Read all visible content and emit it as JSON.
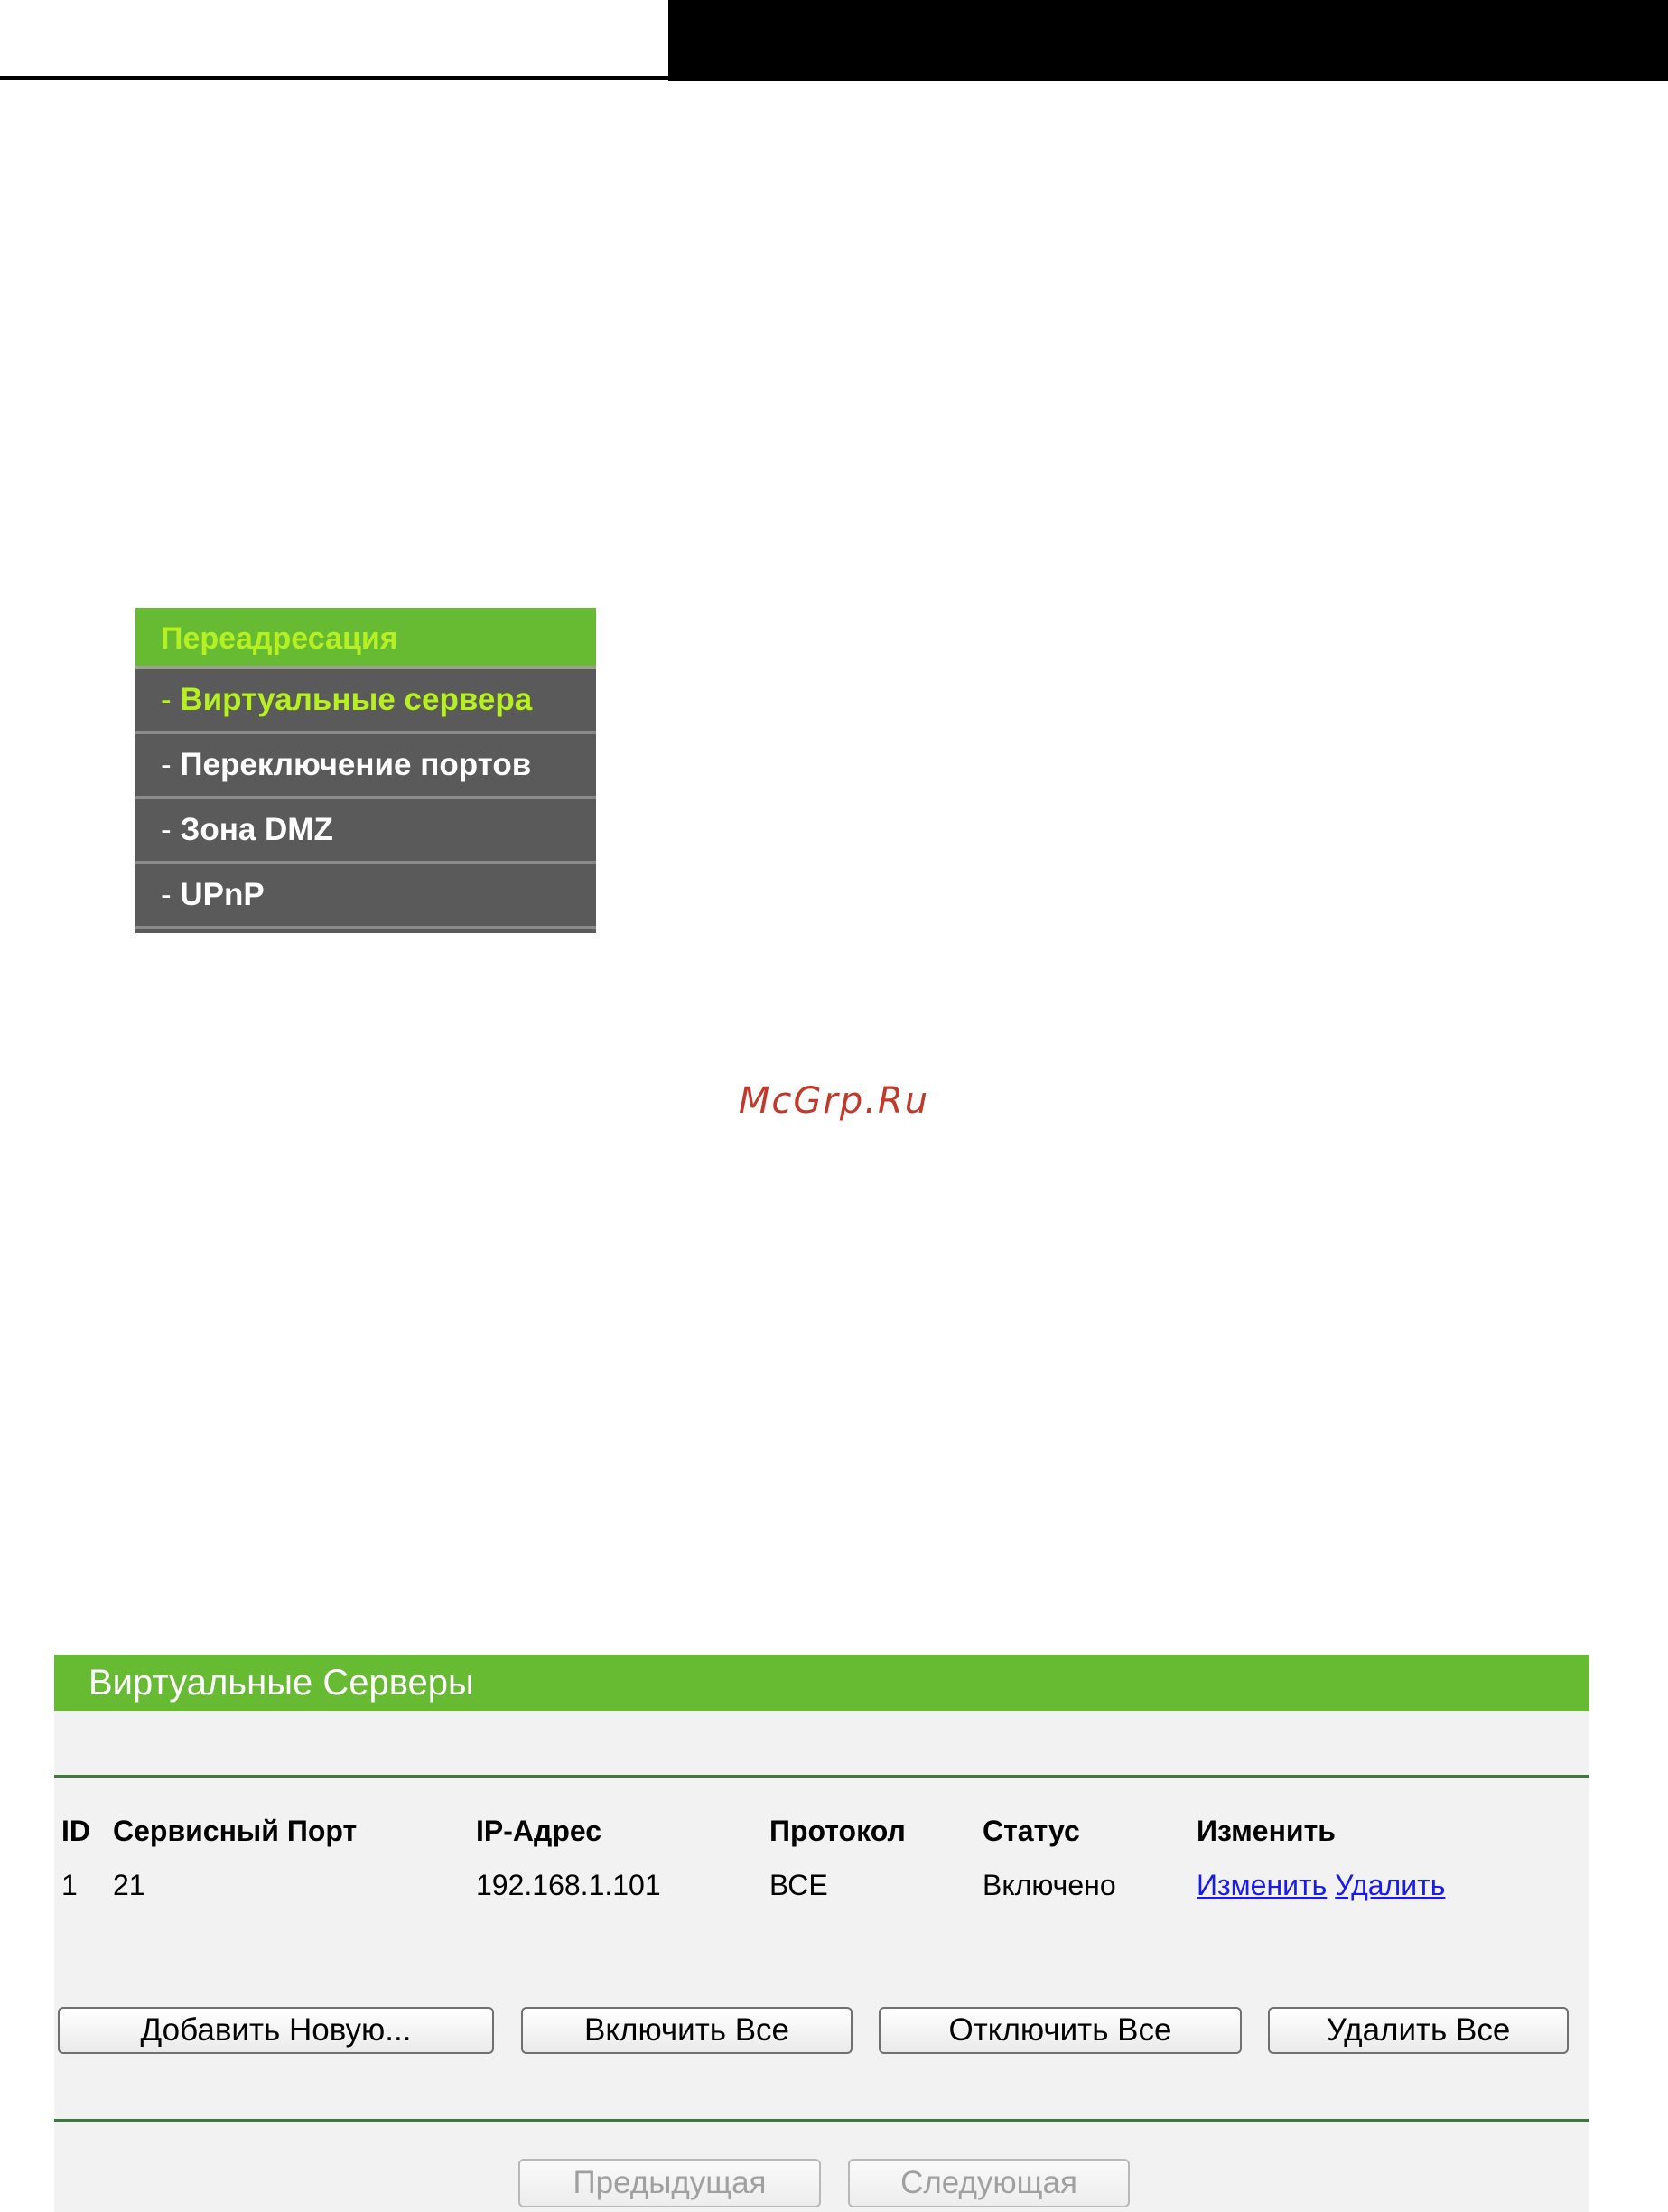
{
  "menu": {
    "title": "Переадресация",
    "items": [
      {
        "label": "Виртуальные сервера",
        "active": true
      },
      {
        "label": "Переключение портов",
        "active": false
      },
      {
        "label": "Зона DMZ",
        "active": false
      },
      {
        "label": "UPnP",
        "active": false
      }
    ],
    "item_prefix": "- "
  },
  "watermark": "McGrp.Ru",
  "panel": {
    "title": "Виртуальные Серверы",
    "columns": {
      "id": "ID",
      "port": "Сервисный Порт",
      "ip": "IP-Адрес",
      "protocol": "Протокол",
      "status": "Статус",
      "edit": "Изменить"
    },
    "rows": [
      {
        "id": "1",
        "port": "21",
        "ip": "192.168.1.101",
        "protocol": "ВСЕ",
        "status": "Включено",
        "edit_link": "Изменить",
        "delete_link": "Удалить"
      }
    ],
    "buttons": {
      "add": "Добавить Новую...",
      "enable_all": "Включить Все",
      "disable_all": "Отключить Все",
      "delete_all": "Удалить Все",
      "previous": "Предыдущая",
      "next": "Следующая"
    }
  },
  "colors": {
    "accent_green": "#66bb33",
    "menu_active_text": "#b7f022",
    "menu_background": "#5a5a5a",
    "link": "#1a1aee",
    "watermark": "#c0392b"
  }
}
